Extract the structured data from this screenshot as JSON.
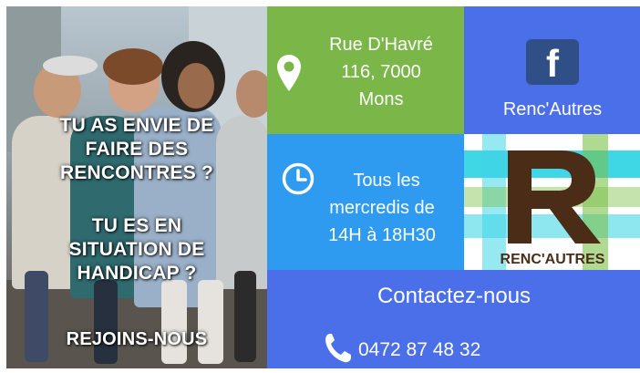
{
  "photo": {
    "line1": "TU AS ENVIE DE",
    "line2": "FAIRE DES",
    "line3": "RENCONTRES ?",
    "line4": "TU ES EN",
    "line5": "SITUATION DE",
    "line6": "HANDICAP ?",
    "line7": "REJOINS-NOUS"
  },
  "address": {
    "icon": "map-pin-icon",
    "line1": "Rue D'Havré",
    "line2": "116, 7000",
    "line3": "Mons"
  },
  "facebook": {
    "icon": "facebook-icon",
    "glyph": "f",
    "name": "Renc'Autres"
  },
  "schedule": {
    "icon": "clock-icon",
    "line1": "Tous les",
    "line2": "mercredis de",
    "line3": "14H à 18H30"
  },
  "logo": {
    "letter": "R",
    "name": "RENC'AUTRES"
  },
  "contact": {
    "title": "Contactez-nous",
    "icon": "phone-icon",
    "phone": "0472 87 48 32"
  },
  "colors": {
    "green": "#7ab648",
    "blue": "#4a6fe8",
    "light_blue": "#2e9af0",
    "facebook_dark": "#2f4f86",
    "logo_brown": "#4b2c17",
    "logo_cyan": "#3fd6e6",
    "logo_green": "#7cc04a"
  }
}
